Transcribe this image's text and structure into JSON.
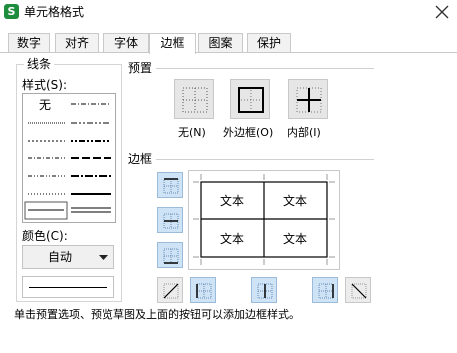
{
  "window": {
    "title": "单元格格式",
    "app_icon_letter": "S"
  },
  "tabs": [
    {
      "label": "数字",
      "active": false
    },
    {
      "label": "对齐",
      "active": false
    },
    {
      "label": "字体",
      "active": false
    },
    {
      "label": "边框",
      "active": true
    },
    {
      "label": "图案",
      "active": false
    },
    {
      "label": "保护",
      "active": false
    }
  ],
  "line_group": {
    "title": "线条",
    "style_label": "样式(S):",
    "none_label": "无",
    "color_label": "颜色(C):",
    "color_value": "自动"
  },
  "presets": {
    "title": "预置",
    "none_label": "无(N)",
    "outline_label": "外边框(O)",
    "inside_label": "内部(I)"
  },
  "border": {
    "title": "边框",
    "preview_cells": [
      "文本",
      "文本",
      "文本",
      "文本"
    ]
  },
  "hint": "单击预置选项、预览草图及上面的按钮可以添加边框样式。",
  "colors": {
    "accent_button": "#cfe3f7",
    "accent_border": "#9cbbd8",
    "app_icon": "#1e8e3e"
  }
}
